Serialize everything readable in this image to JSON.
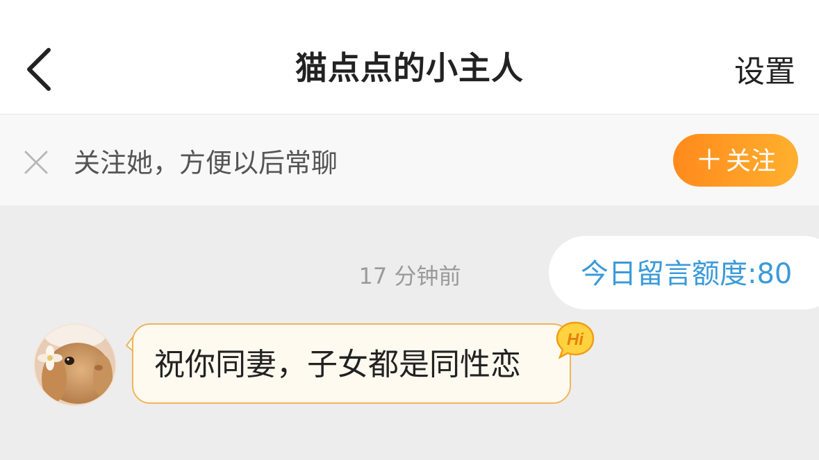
{
  "header": {
    "title": "猫点点的小主人",
    "settings_label": "设置"
  },
  "follow_bar": {
    "prompt": "关注她，方便以后常聊",
    "follow_button_label": "关注",
    "follow_button_plus": "＋"
  },
  "chat": {
    "timestamp": "17 分钟前",
    "quota_text": "今日留言额度:80",
    "message_text": "祝你同妻，子女都是同性恋",
    "hi_badge_text": "Hi"
  },
  "colors": {
    "accent_orange": "#ff9a22",
    "quota_blue": "#3a9ad9",
    "bubble_border": "#f0b45a",
    "bubble_bg": "#fffaf0",
    "chat_bg": "#ededed"
  },
  "icons": {
    "back": "chevron-left-icon",
    "close": "close-icon",
    "badge": "hi-badge-icon"
  }
}
